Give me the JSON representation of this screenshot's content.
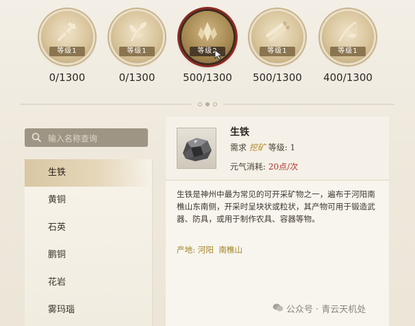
{
  "skills": [
    {
      "icon": "axe-wood-icon",
      "level": "等级1",
      "progress": "0/1300",
      "active": false
    },
    {
      "icon": "herb-leaf-icon",
      "level": "等级1",
      "progress": "0/1300",
      "active": false
    },
    {
      "icon": "ore-pick-icon",
      "level": "等级2",
      "progress": "500/1300",
      "active": true
    },
    {
      "icon": "lumber-icon",
      "level": "等级1",
      "progress": "500/1300",
      "active": false
    },
    {
      "icon": "fishing-rod-icon",
      "level": "等级1",
      "progress": "400/1300",
      "active": false
    }
  ],
  "search": {
    "placeholder": "输入名称查询"
  },
  "list": {
    "items": [
      "生铁",
      "黄铜",
      "石英",
      "鹏铜",
      "花岩",
      "雾玛瑙"
    ],
    "selected_index": 0
  },
  "detail": {
    "name": "生铁",
    "req_prefix": "需求",
    "req_skill": "挖矿",
    "req_level_label": "等级:",
    "req_level_value": "1",
    "cost_label": "元气消耗:",
    "cost_value": "20点/次",
    "description": "生铁是神州中最为常见的可开采矿物之一，遍布于河阳南樵山东南侧，开采时呈块状或粒状，其产物可用于锻造武器、防具，或用于制作农具、容器等物。",
    "origin_label": "产地:",
    "origin_value": "河阳  南樵山"
  },
  "watermark": {
    "text": "公众号 · 青云天机处"
  },
  "colors": {
    "accent_red": "#b2332a",
    "gold": "#a08526",
    "panel": "#f8f5ee"
  }
}
